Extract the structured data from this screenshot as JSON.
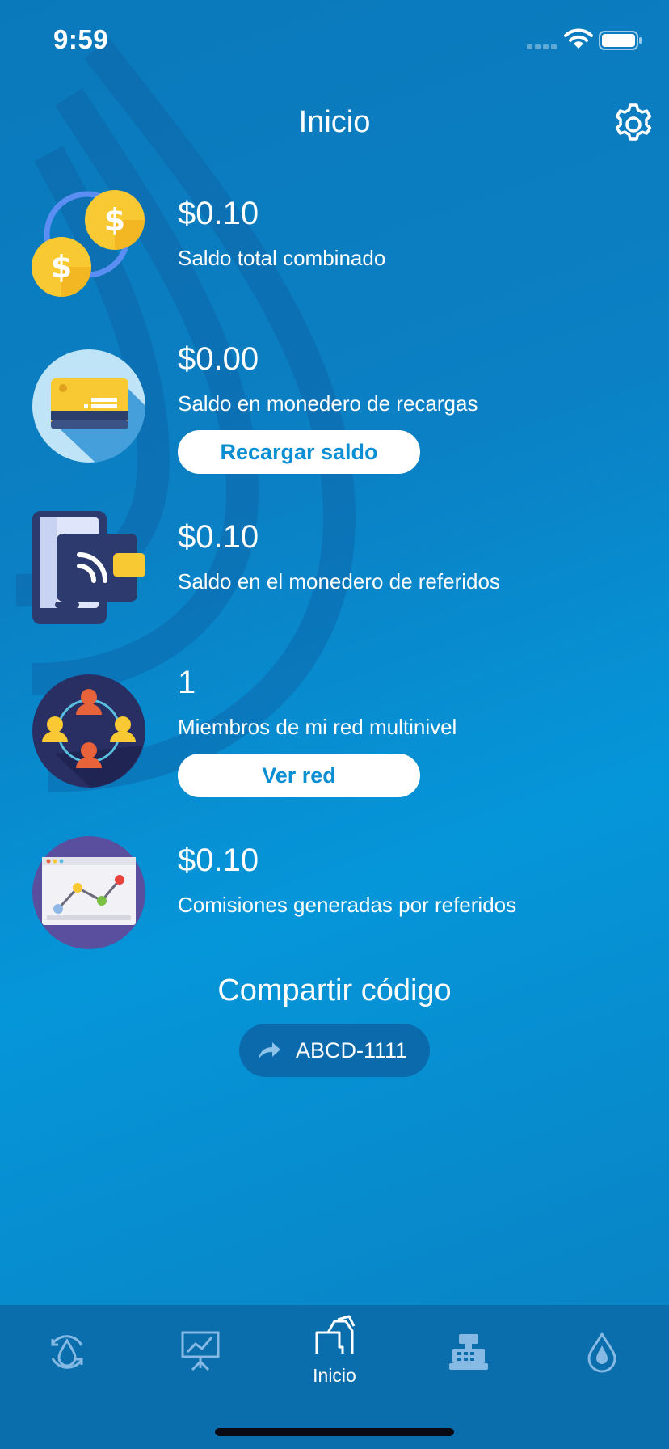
{
  "status_bar": {
    "time": "9:59",
    "icons": [
      "signal-icon",
      "wifi-icon",
      "battery-icon"
    ]
  },
  "header": {
    "title": "Inicio",
    "settings_icon": "gear-icon"
  },
  "rows": [
    {
      "value": "$0.10",
      "label": "Saldo total combinado",
      "icon": "coins-exchange-icon"
    },
    {
      "value": "$0.00",
      "label": "Saldo en monedero de recargas",
      "icon": "card-icon",
      "button": "Recargar saldo"
    },
    {
      "value": "$0.10",
      "label": "Saldo en el monedero de referidos",
      "icon": "nfc-wallet-icon"
    },
    {
      "value": "1",
      "label": "Miembros de mi red multinivel",
      "icon": "network-icon",
      "button": "Ver red"
    },
    {
      "value": "$0.10",
      "label": "Comisiones generadas por referidos",
      "icon": "line-chart-icon"
    }
  ],
  "share": {
    "title": "Compartir código",
    "code": "ABCD-1111",
    "icon": "share-arrow-icon"
  },
  "tab_bar": {
    "active_index": 2,
    "tabs": [
      {
        "icon": "drop-refresh-icon",
        "label": ""
      },
      {
        "icon": "presentation-chart-icon",
        "label": ""
      },
      {
        "icon": "inicio-icon",
        "label": "Inicio"
      },
      {
        "icon": "cash-register-icon",
        "label": ""
      },
      {
        "icon": "drop-icon",
        "label": ""
      }
    ]
  },
  "colors": {
    "background": "#0a80c2",
    "tab_bar": "#0a6ead",
    "button_text": "#0a8ed3",
    "share_pill": "#0b6aac",
    "coin": "#f9c933"
  }
}
